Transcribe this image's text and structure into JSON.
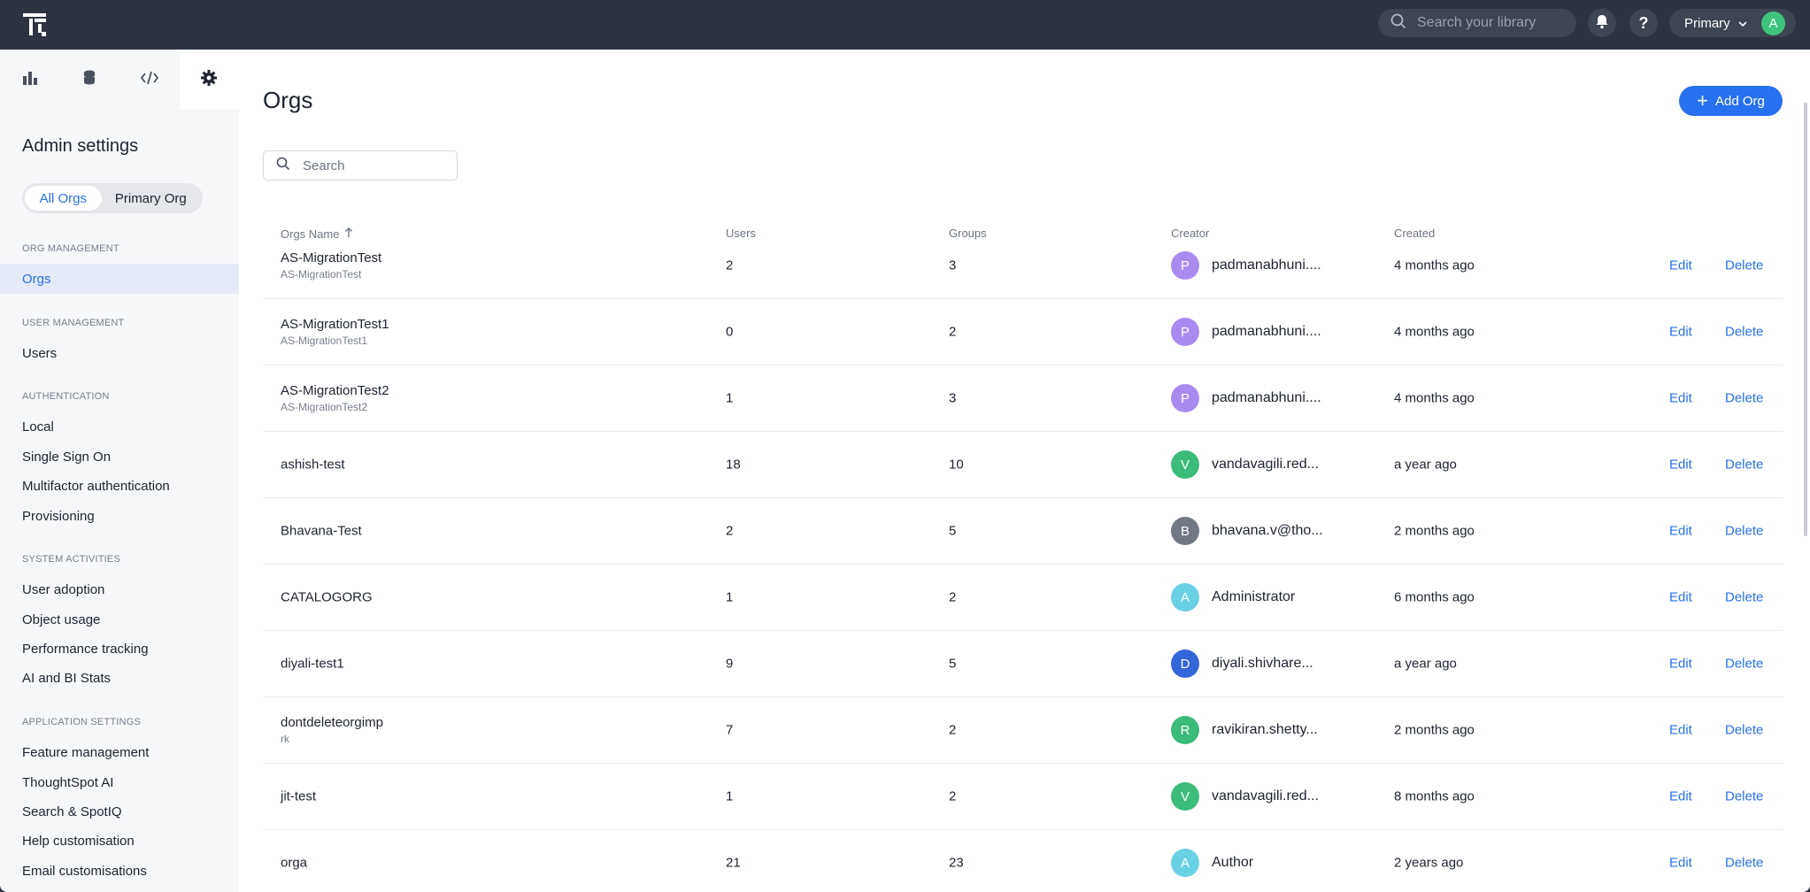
{
  "top_bar": {
    "search_placeholder": "Search your library",
    "org_selector_label": "Primary",
    "user_initial": "A",
    "colors": {
      "bar_bg": "#2d3340",
      "avatar": "#3ec47e"
    },
    "icons": [
      "app-logo-icon",
      "search-icon",
      "bell-icon",
      "help-icon",
      "chevron-down-icon"
    ]
  },
  "sidebar": {
    "tab_icons": [
      "bar-chart-icon",
      "database-icon",
      "code-icon",
      "gear-icon"
    ],
    "title": "Admin settings",
    "scope_toggle": {
      "all_orgs": "All Orgs",
      "primary_org": "Primary Org",
      "selected": "All Orgs"
    },
    "sections": [
      {
        "heading": "ORG MANAGEMENT",
        "items": [
          "Orgs"
        ]
      },
      {
        "heading": "USER MANAGEMENT",
        "items": [
          "Users"
        ]
      },
      {
        "heading": "AUTHENTICATION",
        "items": [
          "Local",
          "Single Sign On",
          "Multifactor authentication",
          "Provisioning"
        ]
      },
      {
        "heading": "SYSTEM ACTIVITIES",
        "items": [
          "User adoption",
          "Object usage",
          "Performance tracking",
          "AI and BI Stats"
        ]
      },
      {
        "heading": "APPLICATION SETTINGS",
        "items": [
          "Feature management",
          "ThoughtSpot AI",
          "Search & SpotIQ",
          "Help customisation",
          "Email customisations"
        ]
      }
    ],
    "active_item": "Orgs"
  },
  "main": {
    "title": "Orgs",
    "add_button": "Add Org",
    "search_placeholder": "Search",
    "columns": {
      "name": "Orgs Name",
      "users": "Users",
      "groups": "Groups",
      "creator": "Creator",
      "created": "Created"
    },
    "sort": {
      "column": "Orgs Name",
      "direction": "ascending"
    },
    "actions": {
      "edit": "Edit",
      "delete": "Delete"
    },
    "accent_color": "#2770ef",
    "rows": [
      {
        "name": "AS-MigrationTest",
        "sub": "AS-MigrationTest",
        "users": "2",
        "groups": "3",
        "creator_initial": "P",
        "creator": "padmanabhuni....",
        "creator_color": "#a98bf0",
        "created": "4 months ago"
      },
      {
        "name": "AS-MigrationTest1",
        "sub": "AS-MigrationTest1",
        "users": "0",
        "groups": "2",
        "creator_initial": "P",
        "creator": "padmanabhuni....",
        "creator_color": "#a98bf0",
        "created": "4 months ago"
      },
      {
        "name": "AS-MigrationTest2",
        "sub": "AS-MigrationTest2",
        "users": "1",
        "groups": "3",
        "creator_initial": "P",
        "creator": "padmanabhuni....",
        "creator_color": "#a98bf0",
        "created": "4 months ago"
      },
      {
        "name": "ashish-test",
        "sub": "",
        "users": "18",
        "groups": "10",
        "creator_initial": "V",
        "creator": "vandavagili.red...",
        "creator_color": "#3dbb7b",
        "created": "a year ago"
      },
      {
        "name": "Bhavana-Test",
        "sub": "",
        "users": "2",
        "groups": "5",
        "creator_initial": "B",
        "creator": "bhavana.v@tho...",
        "creator_color": "#727784",
        "created": "2 months ago"
      },
      {
        "name": "CATALOGORG",
        "sub": "",
        "users": "1",
        "groups": "2",
        "creator_initial": "A",
        "creator": "Administrator",
        "creator_color": "#6ad0e6",
        "created": "6 months ago"
      },
      {
        "name": "diyali-test1",
        "sub": "",
        "users": "9",
        "groups": "5",
        "creator_initial": "D",
        "creator": "diyali.shivhare...",
        "creator_color": "#3366d9",
        "created": "a year ago"
      },
      {
        "name": "dontdeleteorgimp",
        "sub": "rk",
        "users": "7",
        "groups": "2",
        "creator_initial": "R",
        "creator": "ravikiran.shetty...",
        "creator_color": "#3dbb7b",
        "created": "2 months ago"
      },
      {
        "name": "jit-test",
        "sub": "",
        "users": "1",
        "groups": "2",
        "creator_initial": "V",
        "creator": "vandavagili.red...",
        "creator_color": "#3dbb7b",
        "created": "8 months ago"
      },
      {
        "name": "orga",
        "sub": "",
        "users": "21",
        "groups": "23",
        "creator_initial": "A",
        "creator": "Author",
        "creator_color": "#6ad0e6",
        "created": "2 years ago"
      }
    ]
  }
}
